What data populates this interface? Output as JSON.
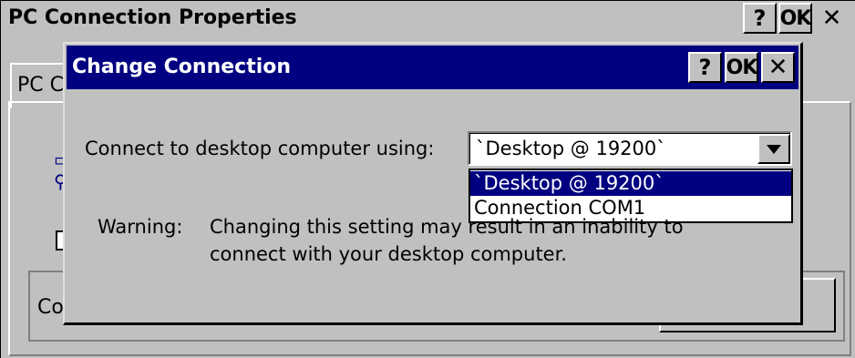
{
  "background_window": {
    "title": "PC Connection Properties",
    "help_label": "?",
    "ok_label": "OK",
    "close_label": "✕",
    "tab_label": "PC C",
    "group_label": "Co"
  },
  "dialog": {
    "title": "Change Connection",
    "help_label": "?",
    "ok_label": "OK",
    "close_label": "✕",
    "connect_label": "Connect to desktop computer using:",
    "combo_value": "`Desktop @ 19200`",
    "dropdown_options": [
      "`Desktop @ 19200`",
      "Connection COM1"
    ],
    "warning_label": "Warning:",
    "warning_line1": "Changing this setting may result in an inability to",
    "warning_line2": "connect with your desktop computer."
  },
  "icons": {
    "help": "question-mark",
    "ok": "ok-text",
    "close": "x-mark",
    "dropdown": "triangle-down"
  },
  "colors": {
    "face": "#c0c0c0",
    "title_active": "#000080",
    "title_text": "#ffffff",
    "selection": "#000080"
  }
}
